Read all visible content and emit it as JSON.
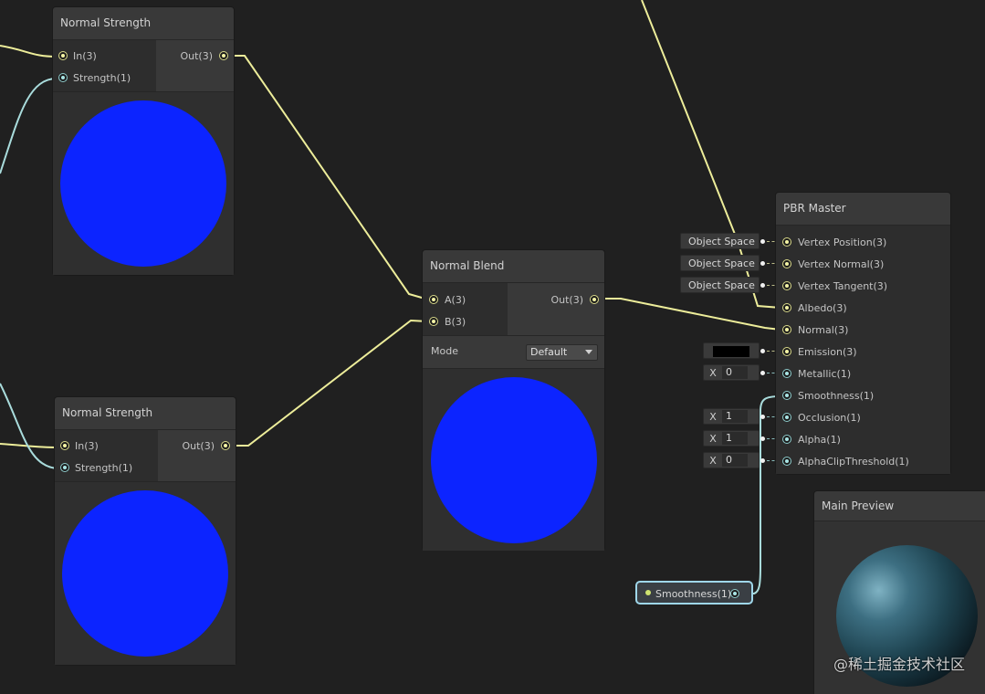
{
  "nodes": {
    "ns1": {
      "title": "Normal Strength",
      "in1": "In(3)",
      "in2": "Strength(1)",
      "out": "Out(3)"
    },
    "ns2": {
      "title": "Normal Strength",
      "in1": "In(3)",
      "in2": "Strength(1)",
      "out": "Out(3)"
    },
    "blend": {
      "title": "Normal Blend",
      "in1": "A(3)",
      "in2": "B(3)",
      "out": "Out(3)",
      "mode_label": "Mode",
      "mode_value": "Default"
    },
    "pbr": {
      "title": "PBR Master",
      "ports": [
        "Vertex Position(3)",
        "Vertex Normal(3)",
        "Vertex Tangent(3)",
        "Albedo(3)",
        "Normal(3)",
        "Emission(3)",
        "Metallic(1)",
        "Smoothness(1)",
        "Occlusion(1)",
        "Alpha(1)",
        "AlphaClipThreshold(1)"
      ],
      "space_fields": [
        "Object Space",
        "Object Space",
        "Object Space"
      ],
      "x_label": "X",
      "metallic": "0",
      "occlusion": "1",
      "alpha": "1",
      "alpha_clip": "0"
    },
    "property": {
      "label": "Smoothness(1)"
    },
    "main_preview": {
      "title": "Main Preview"
    }
  },
  "watermark": "@稀土掘金技术社区",
  "colors": {
    "canvas": "#202020",
    "vector3_port": "#f4f4a4",
    "vector1_port": "#a9e5e5",
    "preview_blue": "#0c24ff"
  }
}
